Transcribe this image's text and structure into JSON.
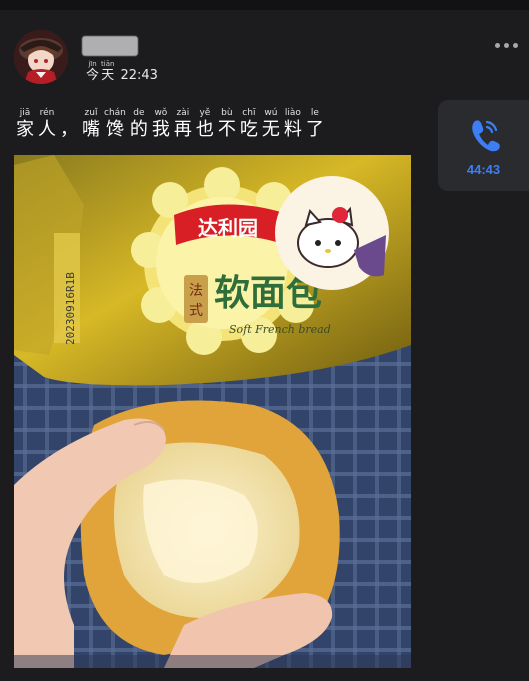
{
  "post": {
    "time_pinyin": [
      "jīn",
      "tiān"
    ],
    "time_chars": [
      "今",
      "天"
    ],
    "time": "22:43",
    "message": [
      {
        "py": "jiā",
        "hz": "家"
      },
      {
        "py": "rén",
        "hz": "人"
      },
      {
        "py": "",
        "hz": "，"
      },
      {
        "py": "zuǐ",
        "hz": "嘴"
      },
      {
        "py": "chán",
        "hz": "馋"
      },
      {
        "py": "de",
        "hz": "的"
      },
      {
        "py": "wǒ",
        "hz": "我"
      },
      {
        "py": "zài",
        "hz": "再"
      },
      {
        "py": "yě",
        "hz": "也"
      },
      {
        "py": "bù",
        "hz": "不"
      },
      {
        "py": "chī",
        "hz": "吃"
      },
      {
        "py": "wú",
        "hz": "无"
      },
      {
        "py": "liào",
        "hz": "料"
      },
      {
        "py": "le",
        "hz": "了"
      }
    ]
  },
  "call": {
    "duration": "44:43",
    "icon": "phone-icon",
    "color": "#3e7ef5"
  },
  "photo": {
    "package_brand": "达利园",
    "package_product": "软面包",
    "package_badge": "法式",
    "package_english": "Soft French bread",
    "package_date": "20230916R1B"
  }
}
